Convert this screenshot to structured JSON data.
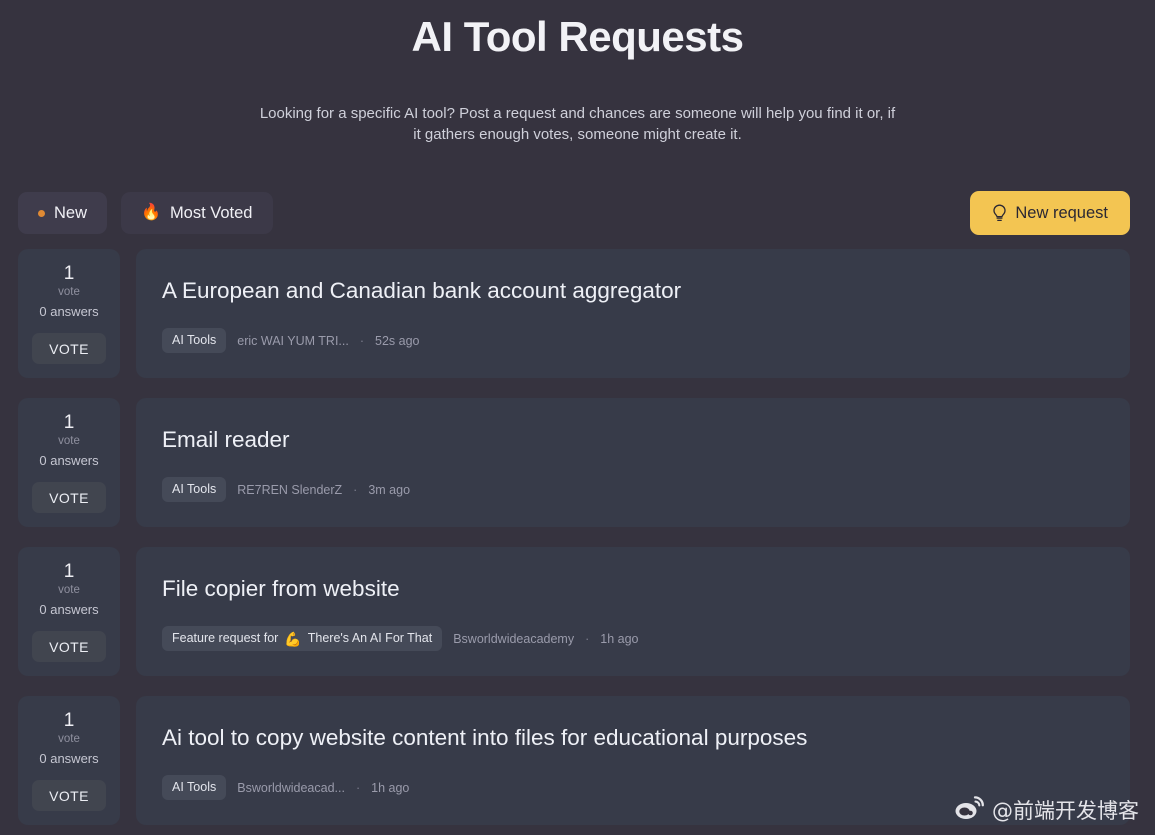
{
  "header": {
    "title": "AI Tool Requests",
    "subtitle": "Looking for a specific AI tool? Post a request and chances are someone will help you find it or, if it gathers enough votes, someone might create it."
  },
  "toolbar": {
    "tabs": [
      {
        "label": "New",
        "icon": "orange-dot-icon",
        "active": true
      },
      {
        "label": "Most Voted",
        "icon": "fire-icon",
        "active": false
      }
    ],
    "new_request_label": "New request",
    "new_request_icon": "lightbulb-icon",
    "accent_color": "#f3c552"
  },
  "requests": [
    {
      "votes": "1",
      "vote_word": "vote",
      "answers": "0 answers",
      "vote_button": "VOTE",
      "title": "A European and Canadian bank account aggregator",
      "tag": "AI Tools",
      "tag_emoji": "",
      "author": "eric WAI YUM TRI...",
      "separator": "·",
      "time": "52s ago"
    },
    {
      "votes": "1",
      "vote_word": "vote",
      "answers": "0 answers",
      "vote_button": "VOTE",
      "title": "Email reader",
      "tag": "AI Tools",
      "tag_emoji": "",
      "author": "RE7REN SlenderZ",
      "separator": "·",
      "time": "3m ago"
    },
    {
      "votes": "1",
      "vote_word": "vote",
      "answers": "0 answers",
      "vote_button": "VOTE",
      "title": "File copier from website",
      "tag": "Feature request for",
      "tag_emoji": "💪",
      "tag_suffix": "There's An AI For That",
      "author": "Bsworldwideacademy",
      "separator": "·",
      "time": "1h ago"
    },
    {
      "votes": "1",
      "vote_word": "vote",
      "answers": "0 answers",
      "vote_button": "VOTE",
      "title": "Ai tool to copy website content into files for educational purposes",
      "tag": "AI Tools",
      "tag_emoji": "",
      "author": "Bsworldwideacad...",
      "separator": "·",
      "time": "1h ago"
    }
  ],
  "watermark": {
    "handle": "@前端开发博客",
    "icon": "weibo-icon"
  }
}
